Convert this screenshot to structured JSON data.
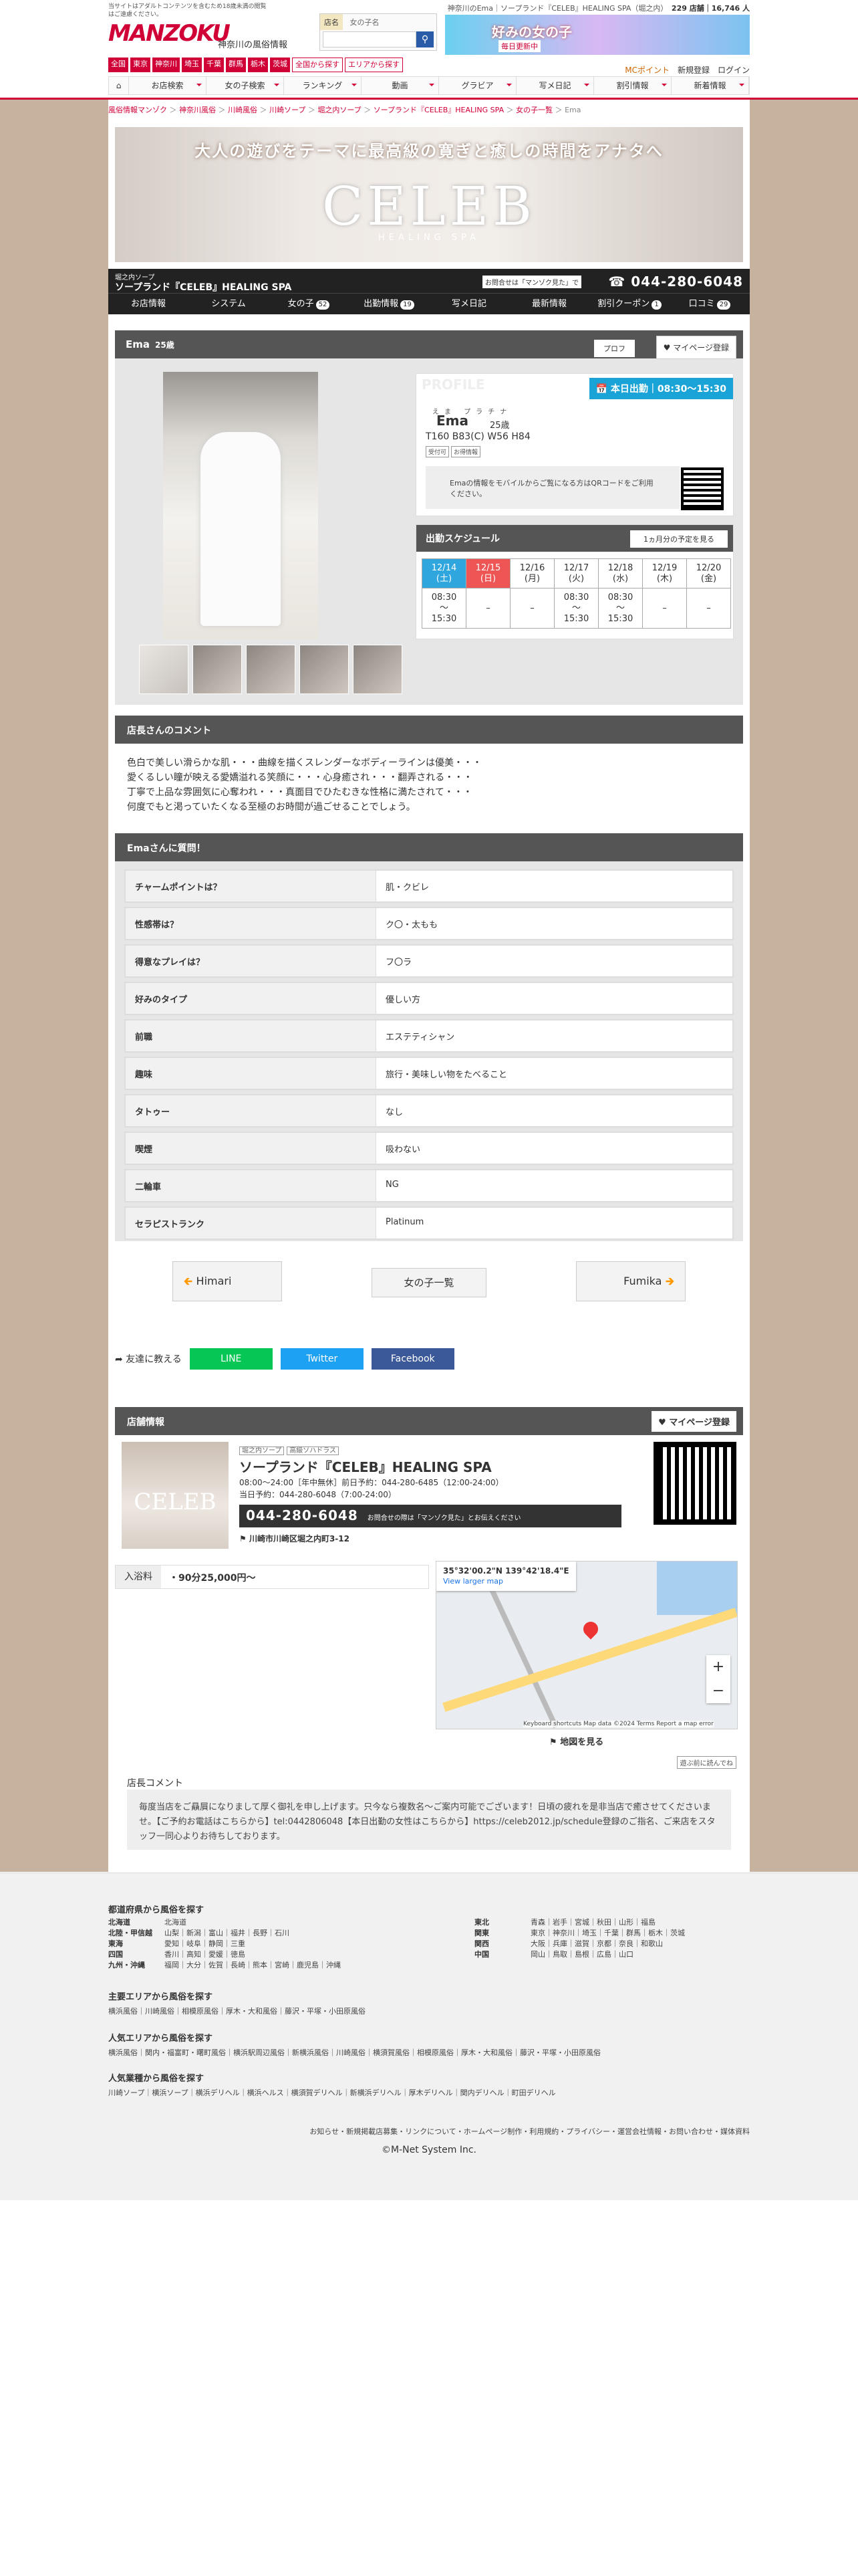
{
  "site": {
    "tagline": "当サイトはアダルトコンテンツを含むため18歳未満の閲覧はご遠慮ください。",
    "logo": "MANZOKU",
    "region": "神奈川の風俗情報",
    "prefs": [
      "全国",
      "東京",
      "神奈川",
      "埼玉",
      "千葉",
      "群馬",
      "栃木",
      "茨城"
    ],
    "pref_buttons": [
      "全国から探す",
      "エリアから探す"
    ],
    "search_tabs": [
      "店名",
      "女の子名"
    ],
    "search_placeholder": "",
    "stats": "神奈川のEma｜ソープランド『CELEB』HEALING SPA（堀之内）",
    "stats_count": "229 店舗｜16,746 人",
    "top_banner_title": "好みの女の子",
    "top_banner_sub": "毎日更新中",
    "mc_point": "MCポイント",
    "register": "新規登録",
    "login": "ログイン",
    "nav": [
      "お店検索",
      "女の子検索",
      "ランキング",
      "動画",
      "グラビア",
      "写メ日記",
      "割引情報",
      "新着情報"
    ]
  },
  "breadcrumb": [
    "風俗情報マンゾク",
    "神奈川風俗",
    "川崎風俗",
    "川崎ソープ",
    "堀之内ソープ",
    "ソープランド『CELEB』HEALING SPA",
    "女の子一覧",
    "Ema"
  ],
  "hero": {
    "headline": "大人の遊びをテーマに最高級の寛ぎと癒しの時間をアナタへ",
    "brand": "CELEB",
    "spa": "HEALING SPA"
  },
  "shop": {
    "kind": "堀之内ソープ",
    "name": "ソープランド『CELEB』HEALING SPA",
    "ask": "お問合せは「マンゾク見た」で",
    "tel": "044-280-6048",
    "nav": [
      {
        "label": "お店情報",
        "count": ""
      },
      {
        "label": "システム",
        "count": ""
      },
      {
        "label": "女の子",
        "count": "52"
      },
      {
        "label": "出勤情報",
        "count": "19"
      },
      {
        "label": "写メ日記",
        "count": ""
      },
      {
        "label": "最新情報",
        "count": ""
      },
      {
        "label": "割引クーポン",
        "count": "1"
      },
      {
        "label": "口コミ",
        "count": "29"
      }
    ]
  },
  "girl": {
    "name": "Ema",
    "age": "25歳",
    "tab_profile": "プロフ",
    "mypage": "マイページ登録",
    "profile_label": "PROFILE",
    "today": "本日出勤｜08:30〜15:30",
    "kana": "えま",
    "kana2": "プラチナ",
    "measurements": "T160 B83(C) W56 H84",
    "badges": [
      "受付可",
      "お得情報"
    ],
    "mobile_note": "Emaの情報をモバイルからご覧になる方はQRコードをご利用ください。"
  },
  "schedule": {
    "title": "出勤スケジュール",
    "more": "1ヵ月分の予定を見る",
    "days": [
      {
        "date": "12/14",
        "dow": "(土)",
        "time": "08:30\n〜\n15:30",
        "cls": "sat"
      },
      {
        "date": "12/15",
        "dow": "(日)",
        "time": "–",
        "cls": "sun"
      },
      {
        "date": "12/16",
        "dow": "(月)",
        "time": "–",
        "cls": ""
      },
      {
        "date": "12/17",
        "dow": "(火)",
        "time": "08:30\n〜\n15:30",
        "cls": ""
      },
      {
        "date": "12/18",
        "dow": "(水)",
        "time": "08:30\n〜\n15:30",
        "cls": ""
      },
      {
        "date": "12/19",
        "dow": "(木)",
        "time": "–",
        "cls": ""
      },
      {
        "date": "12/20",
        "dow": "(金)",
        "time": "–",
        "cls": ""
      }
    ]
  },
  "comment": {
    "title": "店長さんのコメント",
    "lines": [
      "色白で美しい滑らかな肌・・・曲線を描くスレンダーなボディーラインは優美・・・",
      "愛くるしい瞳が映える愛嬌溢れる笑顔に・・・心身癒され・・・翻弄される・・・",
      "丁寧で上品な雰囲気に心奪われ・・・真面目でひたむきな性格に満たされて・・・",
      "何度でもと渇っていたくなる至極のお時間が過ごせることでしょう。"
    ]
  },
  "qa": {
    "title": "Emaさんに質問！",
    "rows": [
      {
        "q": "チャームポイントは？",
        "a": "肌・クビレ"
      },
      {
        "q": "性感帯は？",
        "a": "ク〇・太もも"
      },
      {
        "q": "得意なプレイは？",
        "a": "フ〇ラ"
      },
      {
        "q": "好みのタイプ",
        "a": "優しい方"
      },
      {
        "q": "前職",
        "a": "エステティシャン"
      },
      {
        "q": "趣味",
        "a": "旅行・美味しい物をたべること"
      },
      {
        "q": "タトゥー",
        "a": "なし"
      },
      {
        "q": "喫煙",
        "a": "吸わない"
      },
      {
        "q": "二輪車",
        "a": "NG"
      },
      {
        "q": "セラピストランク",
        "a": "Platinum"
      }
    ]
  },
  "pager": {
    "prev": "Himari",
    "list": "女の子一覧",
    "next": "Fumika"
  },
  "share": {
    "label": "友達に教える",
    "line": "LINE",
    "twitter": "Twitter",
    "facebook": "Facebook"
  },
  "shopinfo": {
    "title": "店舗情報",
    "mypage": "マイページ登録",
    "kind": "堀之内ソープ",
    "tag": "高級ソハドラス",
    "name": "ソープランド『CELEB』HEALING SPA",
    "hours": "08:00〜24:00［年中無休］前日予約：044-280-6485（12:00-24:00）",
    "hours2": "当日予約：044-280-6048（7:00-24:00）",
    "tel": "044-280-6048",
    "tel_note": "お問合せの際は「マンゾク見た」とお伝えください",
    "address": "川崎市川崎区堀之内町3-12",
    "price_label": "入浴料",
    "price": "・90分25,000円〜",
    "map_coord": "35°32'00.2\"N 139°42'18.4\"E",
    "map_link": "View larger map",
    "map_footer": "Keyboard shortcuts  Map data ©2024  Terms  Report a map error",
    "map_button": "地図を見る",
    "guide": "遊ぶ前に読んでね",
    "mgr_title": "店長コメント",
    "mgr_text": "毎度当店をご贔屓になりまして厚く御礼を申し上げます。只今なら複数名～ご案内可能でございます！日頃の疲れを是非当店で癒させてくださいませ。【ご予約お電話はこちらから】tel:0442806048【本日出勤の女性はこちらから】https://celeb2012.jp/schedule登録のご指名、ご来店をスタッフ一同心よりお待ちしております。"
  },
  "footer": {
    "pref_title": "都道府県から風俗を探す",
    "pref_left": [
      {
        "r": "北海道",
        "p": "北海道"
      },
      {
        "r": "北陸・甲信越",
        "p": "山梨｜新潟｜富山｜福井｜長野｜石川"
      },
      {
        "r": "東海",
        "p": "愛知｜岐阜｜静岡｜三重"
      },
      {
        "r": "四国",
        "p": "香川｜高知｜愛媛｜徳島"
      },
      {
        "r": "九州・沖縄",
        "p": "福岡｜大分｜佐賀｜長崎｜熊本｜宮崎｜鹿児島｜沖縄"
      }
    ],
    "pref_right": [
      {
        "r": "東北",
        "p": "青森｜岩手｜宮城｜秋田｜山形｜福島"
      },
      {
        "r": "関東",
        "p": "東京｜神奈川｜埼玉｜千葉｜群馬｜栃木｜茨城"
      },
      {
        "r": "関西",
        "p": "大阪｜兵庫｜滋賀｜京都｜奈良｜和歌山"
      },
      {
        "r": "中国",
        "p": "岡山｜鳥取｜島根｜広島｜山口"
      }
    ],
    "area_title": "主要エリアから風俗を探す",
    "area_links": "横浜風俗｜川崎風俗｜相模原風俗｜厚木・大和風俗｜藤沢・平塚・小田原風俗",
    "pop_title": "人気エリアから風俗を探す",
    "pop_links": "横浜風俗｜関内・福富町・曙町風俗｜横浜駅周辺風俗｜新横浜風俗｜川崎風俗｜横須賀風俗｜相模原風俗｜厚木・大和風俗｜藤沢・平塚・小田原風俗",
    "type_title": "人気業種から風俗を探す",
    "type_links": "川崎ソープ｜横浜ソープ｜横浜デリヘル｜横浜ヘルス｜横須賀デリヘル｜新横浜デリヘル｜厚木デリヘル｜関内デリヘル｜町田デリヘル",
    "bottom_links": "お知らせ・新規掲載店募集・リンクについて・ホームページ制作・利用規約・プライバシー・運営会社情報・お問い合わせ・媒体資料",
    "copyright": "©M-Net System Inc."
  },
  "colors": {
    "brand": "#d00037",
    "side": "#c6b29f",
    "dark": "#222222",
    "today": "#1aa3d6",
    "line": "#06c755",
    "twitter": "#1da1f2",
    "facebook": "#3b5998"
  }
}
